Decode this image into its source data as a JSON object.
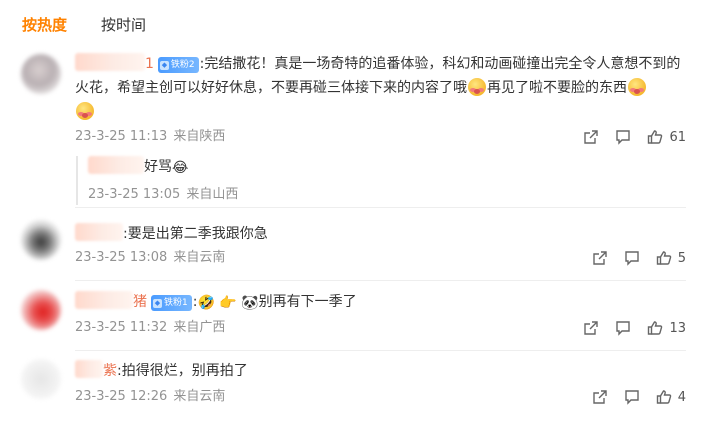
{
  "tabs": [
    {
      "label": "按热度",
      "active": true
    },
    {
      "label": "按时间",
      "active": false
    }
  ],
  "comments": [
    {
      "name_suffix": "1",
      "badge": "铁粉2",
      "text_1": ":完结撒花！真是一场奇特的追番体验，科幻和动画碰撞出完全令人意想不到的火花，希望主创可以好好休息，不要再碰三体接下来的内容了哦",
      "text_2": "再见了啦不要脸的东西",
      "date": "23-3-25 11:13",
      "location": "来自陕西",
      "likes": "61",
      "reply": {
        "text": "好骂",
        "emoji": "😂",
        "date": "23-3-25 13:05",
        "location": "来自山西"
      }
    },
    {
      "text": ":要是出第二季我跟你急",
      "date": "23-3-25 13:08",
      "location": "来自云南",
      "likes": "5"
    },
    {
      "name_suffix": "猪",
      "badge": "铁粉1",
      "emojis": [
        "🤣",
        "👉",
        "🐼"
      ],
      "text": "别再有下一季了",
      "date": "23-3-25 11:32",
      "location": "来自广西",
      "likes": "13"
    },
    {
      "name_suffix": "紫",
      "text": ":拍得很烂，别再拍了",
      "date": "23-3-25 12:26",
      "location": "来自云南",
      "likes": "4"
    }
  ],
  "icons": {
    "share": "share-icon",
    "comment": "comment-icon",
    "like": "like-icon"
  },
  "colors": {
    "accent": "#ff8200",
    "username": "#eb7350",
    "meta": "#939393",
    "badge": "#4a9bff"
  }
}
